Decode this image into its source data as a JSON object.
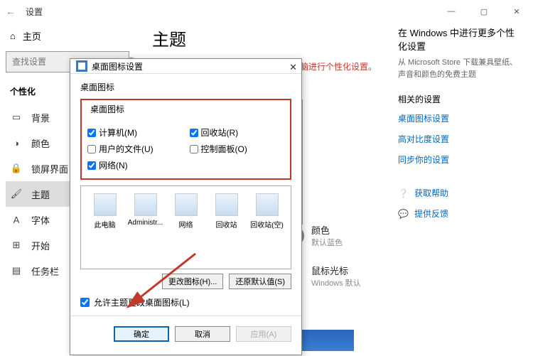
{
  "titlebar": {
    "back": "←",
    "title": "设置"
  },
  "winbuttons": {
    "min": "—",
    "max": "▢",
    "close": "✕"
  },
  "sidebar": {
    "home": "主页",
    "search_placeholder": "查找设置",
    "category": "个性化",
    "items": [
      {
        "icon": "image-icon",
        "glyph": "▭",
        "label": "背景"
      },
      {
        "icon": "palette-icon",
        "glyph": "◑",
        "label": "颜色"
      },
      {
        "icon": "lock-icon",
        "glyph": "🔒",
        "label": "锁屏界面"
      },
      {
        "icon": "theme-icon",
        "glyph": "🖌",
        "label": "主题"
      },
      {
        "icon": "font-icon",
        "glyph": "A",
        "label": "字体"
      },
      {
        "icon": "start-icon",
        "glyph": "⊞",
        "label": "开始"
      },
      {
        "icon": "taskbar-icon",
        "glyph": "▤",
        "label": "任务栏"
      }
    ]
  },
  "main": {
    "heading": "主题",
    "warning": "你需要先激活 Windows，然后才能对电脑进行个性化设置。",
    "color": {
      "label": "颜色",
      "value": "默认蓝色"
    },
    "cursor": {
      "label": "鼠标光标",
      "value": "Windows 默认"
    }
  },
  "right": {
    "more_title": "在 Windows 中进行更多个性化设置",
    "more_desc": "从 Microsoft Store 下载兼具壁纸、声音和颜色的免费主题",
    "related_title": "相关的设置",
    "links": [
      "桌面图标设置",
      "高对比度设置",
      "同步你的设置"
    ],
    "help": "获取帮助",
    "feedback": "提供反馈"
  },
  "dialog": {
    "title": "桌面图标设置",
    "group_label": "桌面图标",
    "checks": {
      "computer": "计算机(M)",
      "recycle": "回收站(R)",
      "userfiles": "用户的文件(U)",
      "control": "控制面板(O)",
      "network": "网络(N)"
    },
    "checked": {
      "computer": true,
      "recycle": true,
      "userfiles": false,
      "control": false,
      "network": true
    },
    "icons": [
      "此电脑",
      "Administr...",
      "网络",
      "回收站",
      "回收站(空)"
    ],
    "change_icon": "更改图标(H)...",
    "restore_default": "还原默认值(S)",
    "allow_themes": "允许主题更改桌面图标(L)",
    "ok": "确定",
    "cancel": "取消",
    "apply": "应用(A)"
  }
}
